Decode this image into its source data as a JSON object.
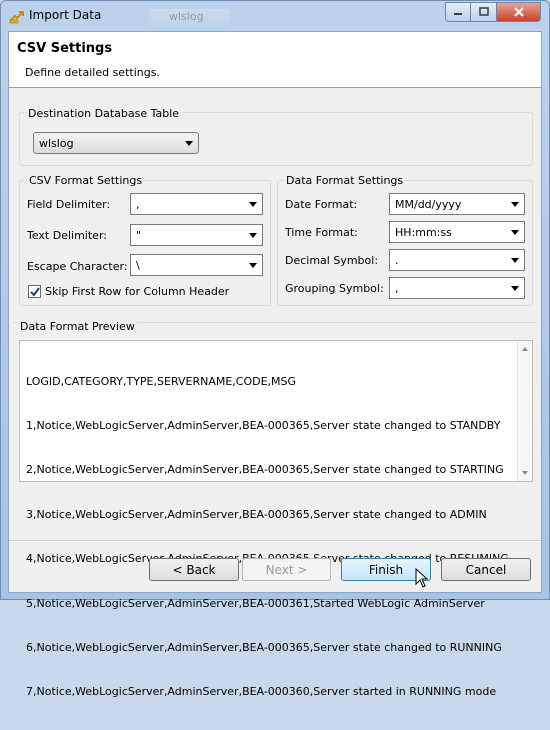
{
  "window": {
    "title": "Import Data",
    "background_tab": "wlslog"
  },
  "header": {
    "title": "CSV Settings",
    "description": "Define detailed settings."
  },
  "destination": {
    "group_label": "Destination Database Table",
    "table": "wlslog"
  },
  "csv_format": {
    "group_label": "CSV Format Settings",
    "field_delimiter": {
      "label": "Field Delimiter:",
      "value": ","
    },
    "text_delimiter": {
      "label": "Text Delimiter:",
      "value": "\""
    },
    "escape_character": {
      "label": "Escape Character:",
      "value": "\\"
    },
    "skip_first_row": {
      "label": "Skip First Row for Column Header",
      "checked": true
    }
  },
  "data_format": {
    "group_label": "Data Format Settings",
    "date_format": {
      "label": "Date Format:",
      "value": "MM/dd/yyyy"
    },
    "time_format": {
      "label": "Time Format:",
      "value": "HH:mm:ss"
    },
    "decimal_symbol": {
      "label": "Decimal Symbol:",
      "value": "."
    },
    "grouping_symbol": {
      "label": "Grouping Symbol:",
      "value": ","
    }
  },
  "preview": {
    "label": "Data Format Preview",
    "lines": [
      "LOGID,CATEGORY,TYPE,SERVERNAME,CODE,MSG",
      "1,Notice,WebLogicServer,AdminServer,BEA-000365,Server state changed to STANDBY",
      "2,Notice,WebLogicServer,AdminServer,BEA-000365,Server state changed to STARTING",
      "3,Notice,WebLogicServer,AdminServer,BEA-000365,Server state changed to ADMIN",
      "4,Notice,WebLogicServer,AdminServer,BEA-000365,Server state changed to RESUMING",
      "5,Notice,WebLogicServer,AdminServer,BEA-000361,Started WebLogic AdminServer",
      "6,Notice,WebLogicServer,AdminServer,BEA-000365,Server state changed to RUNNING",
      "7,Notice,WebLogicServer,AdminServer,BEA-000360,Server started in RUNNING mode"
    ]
  },
  "buttons": {
    "back": "< Back",
    "next": "Next >",
    "finish": "Finish",
    "cancel": "Cancel"
  },
  "colors": {
    "title_bar": "#bcd2ec",
    "close_button": "#c5452d",
    "primary_button": "#bee6fd"
  }
}
